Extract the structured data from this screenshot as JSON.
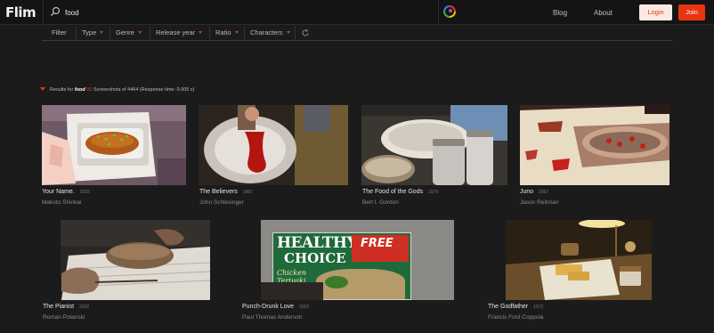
{
  "header": {
    "logo": "Flim",
    "search_value": "food",
    "search_placeholder": "Search",
    "nav": {
      "blog": "Blog",
      "about": "About"
    },
    "login_label": "Login",
    "join_label": "Join"
  },
  "filters": {
    "filter": "Filter",
    "type": "Type",
    "genre": "Genre",
    "release_year": "Release year",
    "ratio": "Ratio",
    "characters": "Characters"
  },
  "results": {
    "prefix": "Results for",
    "query": "food",
    "count": "90",
    "middle": "Screenshots of",
    "total": "4464",
    "time": "(Response time: 0.005 s)"
  },
  "colors": {
    "accent": "#e8340f",
    "background": "#1b1b1b"
  },
  "movies": [
    {
      "title": "Your Name.",
      "year": "2016",
      "director": "Makoto Shinkai"
    },
    {
      "title": "The Believers",
      "year": "1987",
      "director": "John Schlesinger"
    },
    {
      "title": "The Food of the Gods",
      "year": "1976",
      "director": "Bert I. Gordon"
    },
    {
      "title": "Juno",
      "year": "2007",
      "director": "Jason Reitman"
    },
    {
      "title": "The Pianist",
      "year": "2002",
      "director": "Roman Polanski"
    },
    {
      "title": "Punch-Drunk Love",
      "year": "2002",
      "director": "Paul Thomas Anderson"
    },
    {
      "title": "The Godfather",
      "year": "1972",
      "director": "Francis Ford Coppola"
    }
  ],
  "thumbnail_text": {
    "healthy": "HEALTHY",
    "choice": "CHOICE",
    "free": "FREE",
    "chicken": "Chicken",
    "teriyaki": "Teriyaki"
  }
}
